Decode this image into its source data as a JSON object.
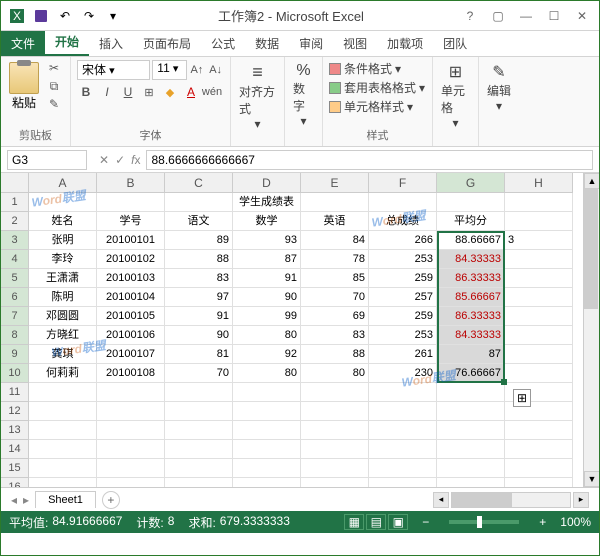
{
  "app": {
    "title": "工作簿2 - Microsoft Excel"
  },
  "tabs": {
    "file": "文件",
    "home": "开始",
    "insert": "插入",
    "layout": "页面布局",
    "formulas": "公式",
    "data": "数据",
    "review": "审阅",
    "view": "视图",
    "addins": "加载项",
    "team": "团队"
  },
  "ribbon": {
    "clipboard": {
      "label": "剪贴板",
      "paste": "粘贴"
    },
    "font": {
      "label": "字体",
      "name": "宋体",
      "size": "11"
    },
    "align": {
      "label": "对齐方式"
    },
    "number": {
      "label": "数字"
    },
    "styles": {
      "label": "样式",
      "cond": "条件格式",
      "table": "套用表格格式",
      "cell": "单元格样式"
    },
    "cells": {
      "label": "单元格"
    },
    "editing": {
      "label": "编辑"
    }
  },
  "formula_bar": {
    "name_box": "G3",
    "value": "88.6666666666667"
  },
  "columns": [
    "A",
    "B",
    "C",
    "D",
    "E",
    "F",
    "G",
    "H"
  ],
  "rows_shown": 17,
  "title_row": "学生成绩表",
  "headers": [
    "姓名",
    "学号",
    "语文",
    "数学",
    "英语",
    "总成绩",
    "平均分"
  ],
  "data_rows": [
    {
      "name": "张明",
      "id": "20100101",
      "c": "89",
      "m": "93",
      "e": "84",
      "total": "266",
      "avg": "88.66667",
      "h": "3"
    },
    {
      "name": "李玲",
      "id": "20100102",
      "c": "88",
      "m": "87",
      "e": "78",
      "total": "253",
      "avg": "84.33333",
      "warn": true
    },
    {
      "name": "王潇潇",
      "id": "20100103",
      "c": "83",
      "m": "91",
      "e": "85",
      "total": "259",
      "avg": "86.33333",
      "warn": true
    },
    {
      "name": "陈明",
      "id": "20100104",
      "c": "97",
      "m": "90",
      "e": "70",
      "total": "257",
      "avg": "85.66667",
      "warn": true
    },
    {
      "name": "邓圆圆",
      "id": "20100105",
      "c": "91",
      "m": "99",
      "e": "69",
      "total": "259",
      "avg": "86.33333",
      "warn": true
    },
    {
      "name": "方晓红",
      "id": "20100106",
      "c": "90",
      "m": "80",
      "e": "83",
      "total": "253",
      "avg": "84.33333",
      "warn": true
    },
    {
      "name": "龚琪",
      "id": "20100107",
      "c": "81",
      "m": "92",
      "e": "88",
      "total": "261",
      "avg": "87"
    },
    {
      "name": "何莉莉",
      "id": "20100108",
      "c": "70",
      "m": "80",
      "e": "80",
      "total": "230",
      "avg": "76.66667"
    }
  ],
  "sheet": {
    "name": "Sheet1"
  },
  "status": {
    "avg_label": "平均值:",
    "avg": "84.91666667",
    "count_label": "计数:",
    "count": "8",
    "sum_label": "求和:",
    "sum": "679.3333333",
    "zoom": "100%"
  },
  "watermark": {
    "a": "W",
    "b": "ord",
    "c": "联盟"
  },
  "chart_data": {
    "type": "table",
    "title": "学生成绩表",
    "columns": [
      "姓名",
      "学号",
      "语文",
      "数学",
      "英语",
      "总成绩",
      "平均分"
    ],
    "rows": [
      [
        "张明",
        "20100101",
        89,
        93,
        84,
        266,
        88.66667
      ],
      [
        "李玲",
        "20100102",
        88,
        87,
        78,
        253,
        84.33333
      ],
      [
        "王潇潇",
        "20100103",
        83,
        91,
        85,
        259,
        86.33333
      ],
      [
        "陈明",
        "20100104",
        97,
        90,
        70,
        257,
        85.66667
      ],
      [
        "邓圆圆",
        "20100105",
        91,
        99,
        69,
        259,
        86.33333
      ],
      [
        "方晓红",
        "20100106",
        90,
        80,
        83,
        253,
        84.33333
      ],
      [
        "龚琪",
        "20100107",
        81,
        92,
        88,
        261,
        87
      ],
      [
        "何莉莉",
        "20100108",
        70,
        80,
        80,
        230,
        76.66667
      ]
    ]
  }
}
